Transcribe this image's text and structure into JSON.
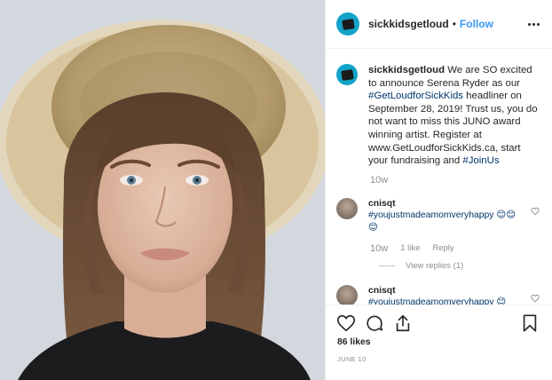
{
  "post": {
    "username": "sickkidsgetloud",
    "dot": "•",
    "follow_label": "Follow",
    "avatar_icon": "sickkids-flag-logo",
    "caption": {
      "username": "sickkidsgetloud",
      "part1": " We are SO excited to announce Serena Ryder as our ",
      "hashtag1": "#GetLoudforSickKids",
      "part2": " headliner on September 28, 2019! Trust us, you do not want to miss this JUNO award winning artist. Register at www.GetLoudforSickKids.ca, start your fundraising and ",
      "hashtag2": "#JoinUs",
      "time": "10w"
    },
    "comments": [
      {
        "username": "cnisqt",
        "text": "#youjustmadeamomveryhappy 😊😊😊",
        "time": "10w",
        "likes": "1 like",
        "reply_label": "Reply",
        "view_replies": "View replies (1)"
      },
      {
        "username": "cnisqt",
        "text": "#youjustmadeamomveryhappy 😊"
      }
    ],
    "likes": "86 likes",
    "date": "JUNE 10"
  },
  "colors": {
    "accent": "#3897f0",
    "hashtag": "#003569",
    "muted": "#8e8e8e",
    "brand": "#12a3c9"
  },
  "icons": [
    "more-icon",
    "heart-icon",
    "comment-icon",
    "share-icon",
    "bookmark-icon"
  ]
}
